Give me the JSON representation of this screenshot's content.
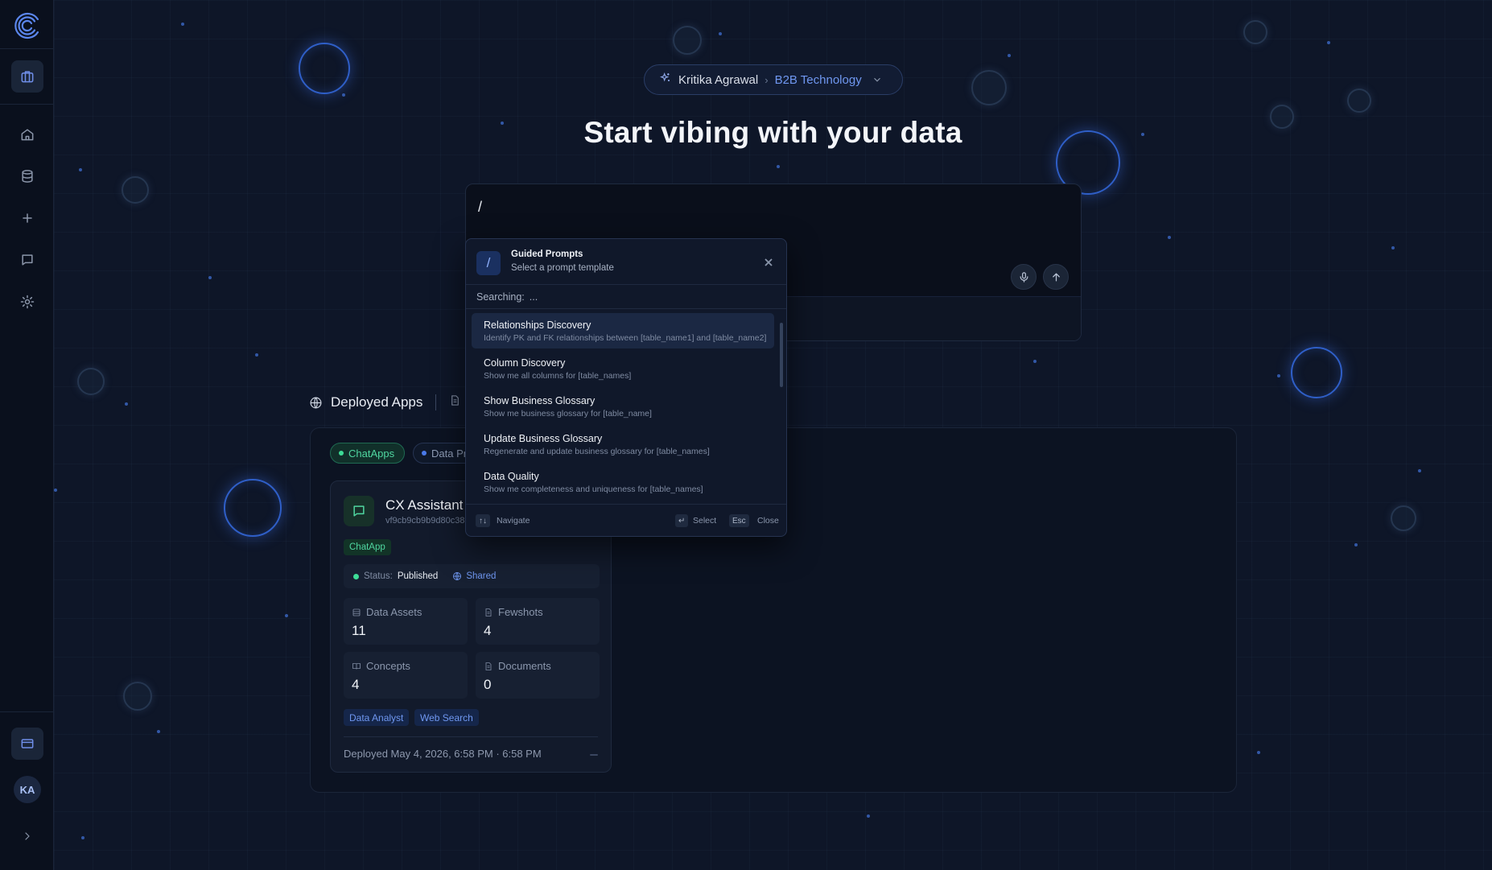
{
  "sidebar": {
    "logo_icon": "spiral-logo-icon",
    "items": [
      {
        "name": "workspace",
        "icon": "briefcase-icon",
        "active": true
      },
      {
        "name": "home",
        "icon": "home-icon"
      },
      {
        "name": "data",
        "icon": "database-icon"
      },
      {
        "name": "new",
        "icon": "plus-icon"
      },
      {
        "name": "chat",
        "icon": "message-icon"
      },
      {
        "name": "settings",
        "icon": "gear-icon"
      }
    ],
    "billing_icon": "card-icon",
    "avatar_initials": "KA",
    "expand_icon": "chevron-right-icon"
  },
  "header": {
    "user": "Kritika Agrawal",
    "separator": "›",
    "org": "B2B Technology",
    "headline": "Start vibing with your data"
  },
  "prompt": {
    "input_value": "/",
    "mic_icon": "microphone-icon",
    "send_icon": "arrow-up-icon"
  },
  "dropdown": {
    "slash": "/",
    "title": "Guided Prompts",
    "subtitle": "Select a prompt template",
    "search_label": "Searching:",
    "search_value": "...",
    "items": [
      {
        "title": "Relationships Discovery",
        "desc": "Identify PK and FK relationships between [table_name1] and [table_name2]",
        "selected": true
      },
      {
        "title": "Column Discovery",
        "desc": "Show me all columns for [table_names]"
      },
      {
        "title": "Show Business Glossary",
        "desc": "Show me business glossary for [table_name]"
      },
      {
        "title": "Update Business Glossary",
        "desc": "Regenerate and update business glossary for [table_names]"
      },
      {
        "title": "Data Quality",
        "desc": "Show me completeness and uniqueness for [table_names]"
      }
    ],
    "footer": {
      "navigate_key": "↑↓",
      "navigate_label": "Navigate",
      "select_key": "↵",
      "select_label": "Select",
      "close_key": "Esc",
      "close_label": "Close"
    }
  },
  "apps": {
    "section_title": "Deployed Apps",
    "chips": [
      "ChatApps",
      "Data Pr"
    ],
    "card": {
      "title": "CX Assistant",
      "id": "vf9cb9cb9b9d80c38",
      "type_tag": "ChatApp",
      "status_label": "Status:",
      "status_value": "Published",
      "shared_label": "Shared",
      "stats": [
        {
          "label": "Data Assets",
          "value": "11"
        },
        {
          "label": "Fewshots",
          "value": "4"
        },
        {
          "label": "Concepts",
          "value": "4"
        },
        {
          "label": "Documents",
          "value": "0"
        }
      ],
      "tags": [
        "Data Analyst",
        "Web Search"
      ],
      "deployed": "Deployed May 4, 2026, 6:58 PM · 6:58 PM"
    }
  },
  "colors": {
    "background": "#0e1628",
    "accent": "#6f97f0",
    "success": "#3ddc97"
  }
}
